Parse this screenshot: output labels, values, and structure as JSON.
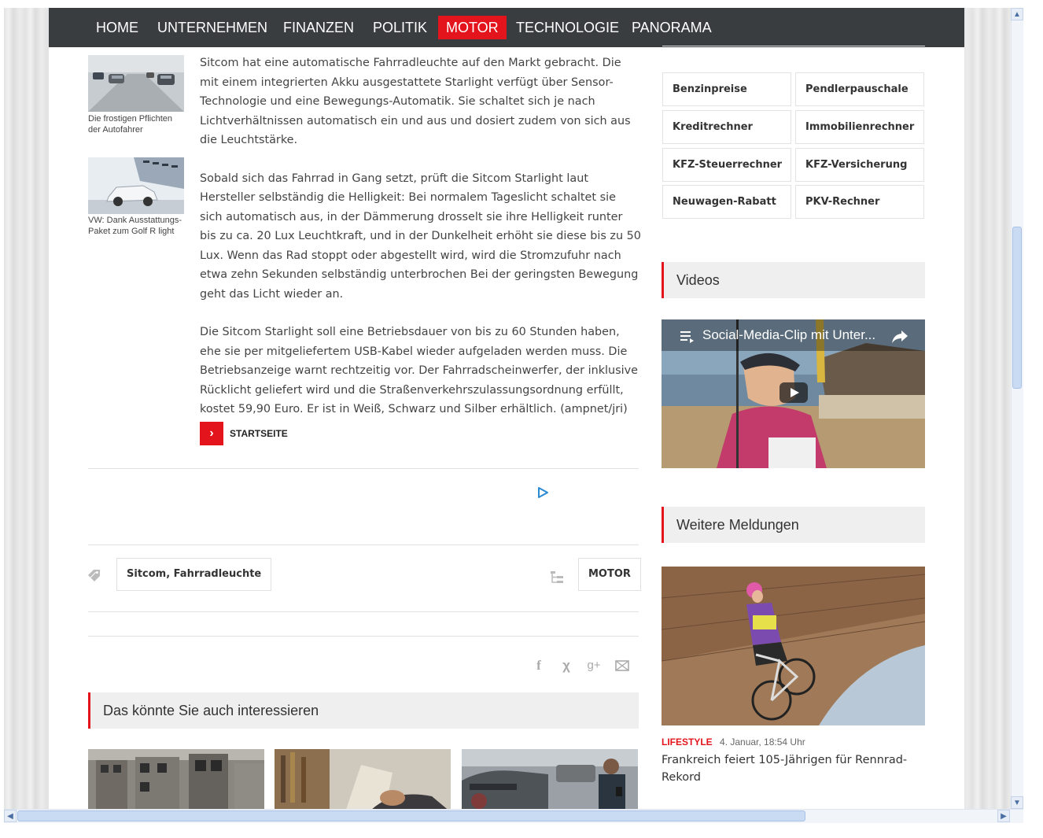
{
  "nav": {
    "items": [
      "HOME",
      "UNTERNEHMEN",
      "FINANZEN",
      "POLITIK",
      "MOTOR",
      "TECHNOLOGIE",
      "PANORAMA"
    ],
    "active": "MOTOR",
    "accent_color": "#e3141c",
    "bar_color": "#3a3d40"
  },
  "related_thumbs": [
    {
      "caption": "Die frostigen Pflichten der Autofahrer"
    },
    {
      "caption": "VW: Dank Ausstattungs-Paket zum Golf R light"
    }
  ],
  "article": {
    "paragraphs": [
      "Sitcom hat eine automatische Fahrradleuchte auf den Markt gebracht. Die mit einem integrierten Akku ausgestattete Starlight verfügt über Sensor-Technologie und eine Bewegungs-Automatik. Sie schaltet sich je nach Lichtverhältnissen automatisch ein und aus und dosiert zudem von sich aus die Leuchtstärke.",
      "Sobald sich das Fahrrad in Gang setzt, prüft die Sitcom Starlight laut Hersteller selbständig die Helligkeit: Bei normalem Tageslicht schaltet sie sich automatisch aus, in der Dämmerung drosselt sie ihre Helligkeit runter bis zu ca. 20 Lux Leuchtkraft, und in der Dunkelheit erhöht sie diese bis zu 50 Lux. Wenn das Rad stoppt oder abgestellt wird, wird die Stromzufuhr nach etwa zehn Sekunden selbständig unterbrochen Bei der geringsten Bewegung geht das Licht wieder an.",
      "Die Sitcom Starlight soll eine Betriebsdauer von bis zu 60 Stunden haben, ehe sie per mitgeliefertem USB-Kabel wieder aufgeladen werden muss. Die Betriebsanzeige warnt rechtzeitig vor. Der Fahrradscheinwerfer, der inklusive Rücklicht geliefert wird und die Straßenverkehrszulassungsordnung erfüllt, kostet 59,90 Euro. Er ist in Weiß, Schwarz und Silber erhältlich. (ampnet/jri)"
    ],
    "start_link": "STARTSEITE"
  },
  "tags": {
    "keywords": "Sitcom, Fahrradleuchte",
    "category": "MOTOR"
  },
  "share_icons": [
    "facebook-icon",
    "xing-icon",
    "google-plus-icon",
    "mail-icon"
  ],
  "related_section": {
    "title": "Das könnte Sie auch interessieren"
  },
  "calculators": [
    "Benzinpreise",
    "Pendlerpauschale",
    "Kreditrechner",
    "Immobilienrechner",
    "KFZ-Steuerrechner",
    "KFZ-Versicherung",
    "Neuwagen-Rabatt",
    "PKV-Rechner"
  ],
  "videos": {
    "title": "Videos",
    "clip_title": "Social-Media-Clip mit Unter..."
  },
  "more_news": {
    "title": "Weitere Meldungen",
    "category": "LIFESTYLE",
    "date": "4. Januar, 18:54 Uhr",
    "headline": "Frankreich feiert 105-Jährigen für Rennrad-Rekord"
  }
}
